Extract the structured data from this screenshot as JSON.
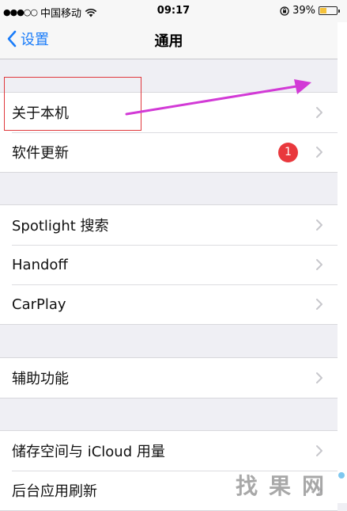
{
  "status_bar": {
    "signal": "●●●○○",
    "carrier": "中国移动",
    "time": "09:17",
    "battery_percent": "39%",
    "battery_level": 0.39
  },
  "nav": {
    "back_label": "设置",
    "title": "通用"
  },
  "groups": [
    {
      "rows": [
        {
          "label": "关于本机"
        },
        {
          "label": "软件更新",
          "badge": "1"
        }
      ]
    },
    {
      "rows": [
        {
          "label": "Spotlight 搜索"
        },
        {
          "label": "Handoff"
        },
        {
          "label": "CarPlay"
        }
      ]
    },
    {
      "rows": [
        {
          "label": "辅助功能"
        }
      ]
    },
    {
      "rows": [
        {
          "label": "储存空间与 iCloud 用量"
        },
        {
          "label": "后台应用刷新"
        }
      ]
    }
  ],
  "watermark": {
    "chars": [
      "找",
      "果",
      "网"
    ]
  },
  "colors": {
    "accent": "#1a7cf9",
    "badge": "#e9383d",
    "annotation_box": "#e0383c",
    "annotation_arrow": "#d23ad6",
    "battery": "#f5c23b"
  },
  "icons": {
    "wifi": "wifi-icon",
    "rotation_lock": "rotation-lock-icon",
    "battery": "battery-icon",
    "back": "chevron-left-icon",
    "disclosure": "chevron-right-icon"
  }
}
